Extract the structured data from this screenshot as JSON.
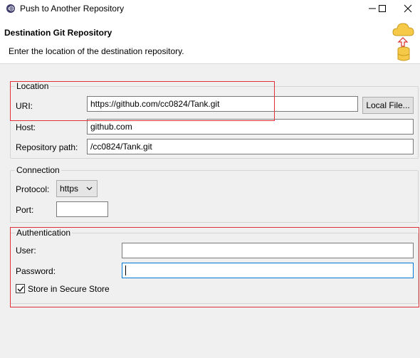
{
  "window": {
    "title": "Push to Another Repository"
  },
  "header": {
    "title": "Destination Git Repository",
    "description": "Enter the location of the destination repository."
  },
  "location": {
    "legend": "Location",
    "uri_label": "URI:",
    "uri_value": "https://github.com/cc0824/Tank.git",
    "local_file_button": "Local File...",
    "host_label": "Host:",
    "host_value": "github.com",
    "repo_path_label": "Repository path:",
    "repo_path_value": "/cc0824/Tank.git"
  },
  "connection": {
    "legend": "Connection",
    "protocol_label": "Protocol:",
    "protocol_value": "https",
    "port_label": "Port:",
    "port_value": ""
  },
  "authentication": {
    "legend": "Authentication",
    "user_label": "User:",
    "user_value": "",
    "password_label": "Password:",
    "password_value": "",
    "store_label": "Store in Secure Store",
    "store_checked": true
  },
  "colors": {
    "highlight": "#e0303a",
    "focus": "#0078d7",
    "cloud": "#f7c948",
    "arrow": "#d93025"
  },
  "icons": {
    "app": "eclipse-icon",
    "wizard": "git-push-icon"
  }
}
